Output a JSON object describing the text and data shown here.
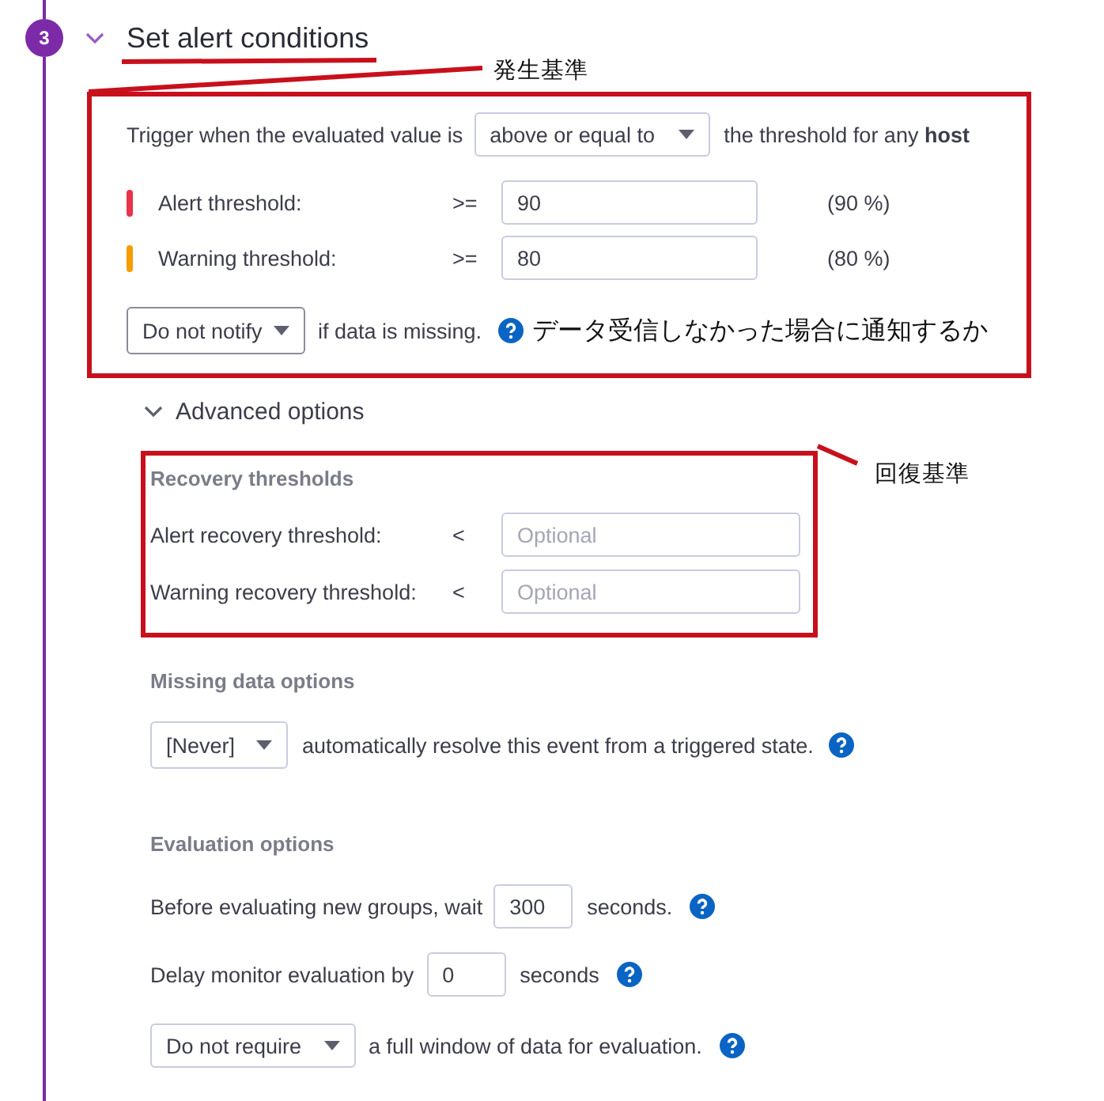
{
  "step": {
    "number": "3",
    "title": "Set alert conditions",
    "expanded": true
  },
  "annotations": [
    {
      "text": "発生基準"
    },
    {
      "text": "回復基準"
    }
  ],
  "trigger": {
    "prefix": "Trigger when the evaluated value is",
    "select": "above or equal to",
    "suffix": "the threshold for any **host**"
  },
  "thresholds": [
    {
      "label": "Alert threshold:",
      "operator": ">=",
      "value": "90",
      "unit": "(90 %)",
      "color": "#e8334a"
    },
    {
      "label": "Warning threshold:",
      "operator": ">=",
      "value": "80",
      "unit": "(80 %)",
      "color": "#f59c00"
    }
  ],
  "notify": {
    "select": "Do not notify",
    "text": "if data is missing.",
    "note": "データ受信しなかった場合に通知するか"
  },
  "advanced": {
    "title": "Advanced options",
    "expanded": true
  },
  "recovery": {
    "title": "Recovery thresholds",
    "rows": [
      {
        "label": "Alert recovery threshold:",
        "operator": "<",
        "placeholder": "Optional"
      },
      {
        "label": "Warning recovery threshold:",
        "operator": "<",
        "placeholder": "Optional"
      }
    ]
  },
  "missing_data": {
    "title": "Missing data options",
    "select": "[Never]",
    "text": "automatically resolve this event from a triggered state."
  },
  "evaluation": {
    "title": "Evaluation options",
    "wait": {
      "prefix": "Before evaluating new groups, wait",
      "value": "300",
      "suffix": "seconds."
    },
    "delay": {
      "prefix": "Delay monitor evaluation by",
      "value": "0",
      "suffix": "seconds"
    },
    "require": {
      "select": "Do not require",
      "text": "a full window of data for evaluation."
    }
  }
}
